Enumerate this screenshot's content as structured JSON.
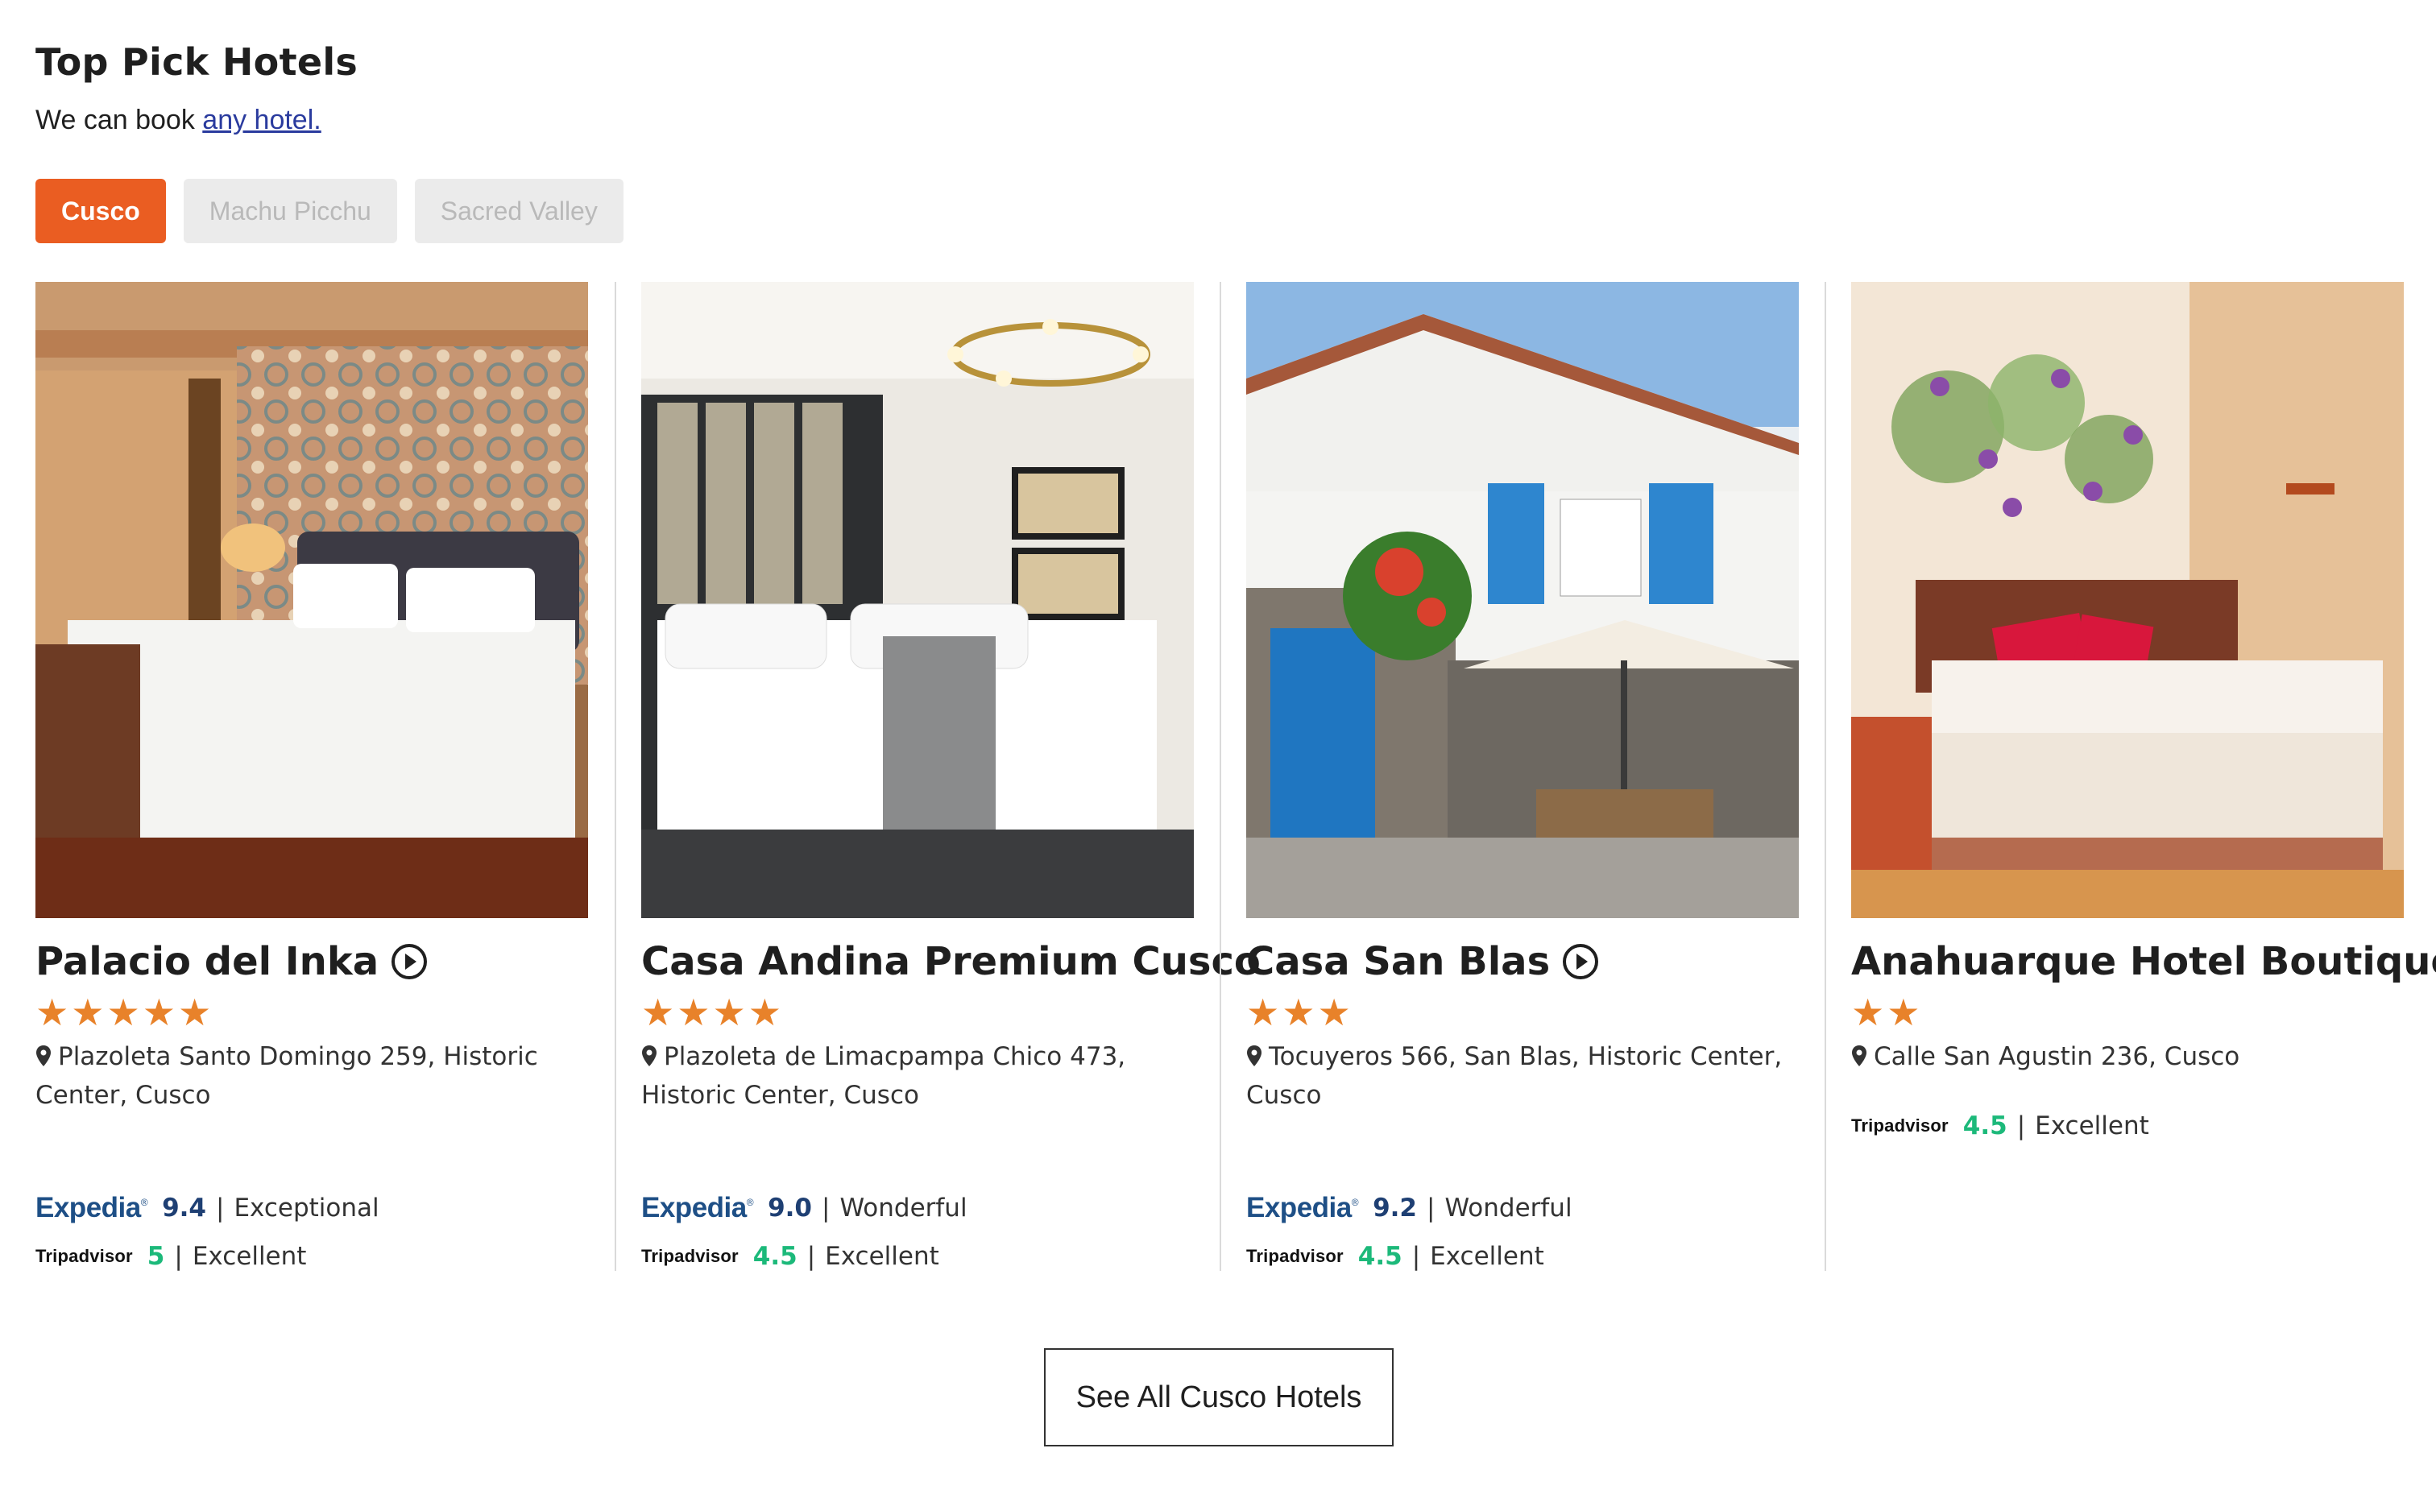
{
  "header": {
    "title": "Top Pick Hotels",
    "subtitle_prefix": "We can book",
    "subtitle_link": "any hotel."
  },
  "tabs": [
    {
      "label": "Cusco",
      "active": true
    },
    {
      "label": "Machu Picchu",
      "active": false
    },
    {
      "label": "Sacred Valley",
      "active": false
    }
  ],
  "hotels": [
    {
      "name": "Palacio del Inka",
      "has_video": true,
      "stars": "★★★★★",
      "star_count": 5,
      "address": "Plazoleta Santo Domingo 259, Historic Center, Cusco",
      "expedia_score": "9.4",
      "expedia_label": "Exceptional",
      "tripadvisor_score": "5",
      "tripadvisor_label": "Excellent"
    },
    {
      "name": "Casa Andina Premium Cusco",
      "has_video": false,
      "stars": "★★★★",
      "star_count": 4,
      "address": "Plazoleta de Limacpampa Chico 473, Historic Center, Cusco",
      "expedia_score": "9.0",
      "expedia_label": "Wonderful",
      "tripadvisor_score": "4.5",
      "tripadvisor_label": "Excellent"
    },
    {
      "name": "Casa San Blas",
      "has_video": true,
      "stars": "★★★",
      "star_count": 3,
      "address": "Tocuyeros 566, San Blas, Historic Center, Cusco",
      "expedia_score": "9.2",
      "expedia_label": "Wonderful",
      "tripadvisor_score": "4.5",
      "tripadvisor_label": "Excellent"
    },
    {
      "name": "Anahuarque Hotel Boutique",
      "has_video": false,
      "stars": "★★",
      "star_count": 2,
      "address": "Calle San Agustin 236, Cusco",
      "tripadvisor_score": "4.5",
      "tripadvisor_label": "Excellent"
    }
  ],
  "brands": {
    "expedia": "Expedia",
    "tripadvisor": "Tripadvisor"
  },
  "see_all_label": "See All Cusco Hotels",
  "colors": {
    "accent": "#ea5d22",
    "star": "#e8822a",
    "expedia": "#1e4f86",
    "tripadvisor_score": "#1cb97a",
    "link": "#2a3b9e"
  },
  "icons": [
    "map-pin-icon",
    "play-circle-icon"
  ]
}
